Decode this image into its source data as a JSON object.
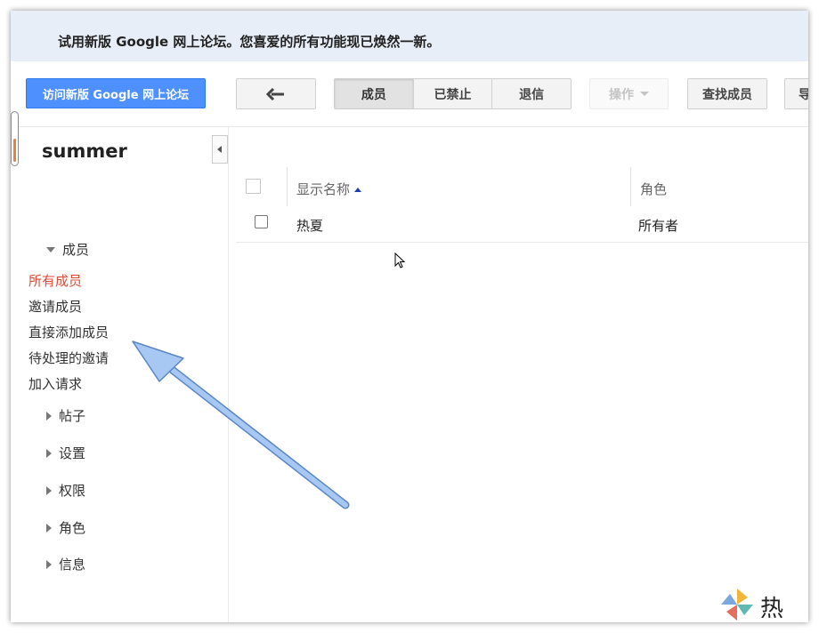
{
  "banner": {
    "text": "试用新版 Google 网上论坛。您喜爱的所有功能现已焕然一新。"
  },
  "toolbar": {
    "visit_new_label": "访问新版 Google 网上论坛",
    "tabs": [
      "成员",
      "已禁止",
      "退信"
    ],
    "actions_label": "操作",
    "find_member_label": "查找成员",
    "export_label": "导"
  },
  "sidebar": {
    "group_name": "summer",
    "members_header": "成员",
    "member_links": [
      "所有成员",
      "邀请成员",
      "直接添加成员",
      "待处理的邀请",
      "加入请求"
    ],
    "sections": [
      "帖子",
      "设置",
      "权限",
      "角色",
      "信息"
    ]
  },
  "table": {
    "headers": [
      "显示名称",
      "角色"
    ],
    "rows": [
      {
        "name": "热夏",
        "role": "所有者"
      }
    ]
  },
  "watermark": {
    "text": "热夏"
  },
  "colors": {
    "accent_blue": "#4d90fe",
    "active_link": "#dd4b39",
    "banner_bg": "#e8eef8",
    "arrow": "#a6c8f2"
  }
}
